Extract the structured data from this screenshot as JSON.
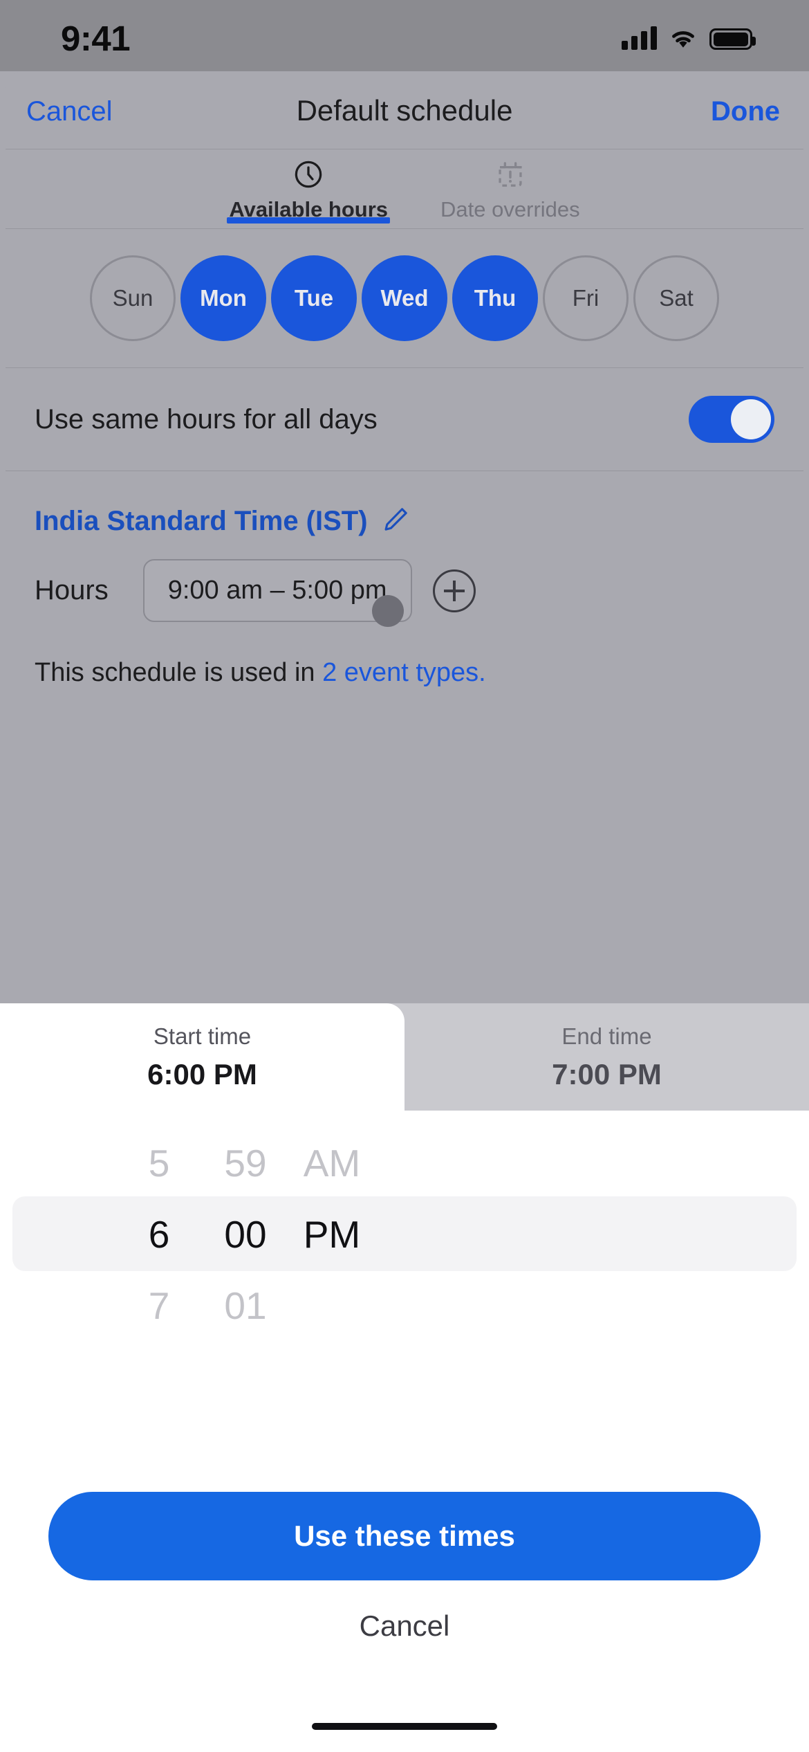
{
  "status_bar": {
    "time": "9:41",
    "signal_icon": "cellular-signal-icon",
    "wifi_icon": "wifi-icon",
    "battery_icon": "battery-icon"
  },
  "sheet": {
    "cancel_label": "Cancel",
    "title": "Default schedule",
    "done_label": "Done",
    "tabs": [
      {
        "label": "Available hours",
        "icon": "clock-icon",
        "active": true
      },
      {
        "label": "Date overrides",
        "icon": "calendar-alert-icon",
        "active": false
      }
    ],
    "days": [
      {
        "label": "Sun",
        "selected": false
      },
      {
        "label": "Mon",
        "selected": true
      },
      {
        "label": "Tue",
        "selected": true
      },
      {
        "label": "Wed",
        "selected": true
      },
      {
        "label": "Thu",
        "selected": true
      },
      {
        "label": "Fri",
        "selected": false
      },
      {
        "label": "Sat",
        "selected": false
      }
    ],
    "same_hours_label": "Use same hours for all days",
    "same_hours_on": true,
    "timezone_label": "India Standard Time (IST)",
    "timezone_edit_icon": "pencil-icon",
    "hours_label": "Hours",
    "hours_value": "9:00 am – 5:00 pm",
    "add_hours_icon": "plus-circle-icon",
    "usage_note_prefix": "This schedule is used in ",
    "usage_note_link": "2 event types."
  },
  "time_picker": {
    "start_tab_label": "Start time",
    "start_tab_value": "6:00 PM",
    "end_tab_label": "End time",
    "end_tab_value": "7:00 PM",
    "active_tab": "start",
    "wheel": {
      "hours": {
        "above": "5",
        "selected": "6",
        "below": "7"
      },
      "minutes": {
        "above": "59",
        "selected": "00",
        "below": "01"
      },
      "periods": {
        "above": "AM",
        "selected": "PM",
        "below": ""
      }
    },
    "confirm_label": "Use these times",
    "cancel_label": "Cancel"
  },
  "colors": {
    "accent_blue": "#1a56db",
    "button_blue": "#1668e3",
    "sheet_bg": "#a9a9b0",
    "modal_bg": "#ffffff"
  }
}
